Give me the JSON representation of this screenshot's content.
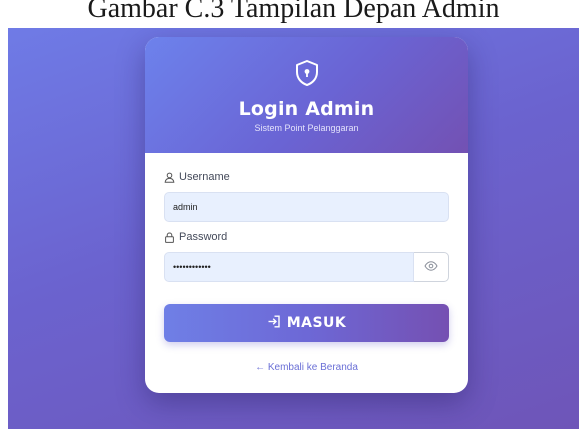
{
  "caption": "Gambar C.3 Tampilan Depan Admin",
  "login": {
    "title": "Login Admin",
    "subtitle": "Sistem Point Pelanggaran",
    "header_icon": "shield-icon",
    "username": {
      "label": "Username",
      "icon": "user-icon",
      "value": "admin"
    },
    "password": {
      "label": "Password",
      "icon": "lock-icon",
      "value": "••••••••••••",
      "toggle_icon": "eye-icon"
    },
    "submit_label": "MASUK",
    "submit_icon": "login-icon",
    "back_link": "← Kembali ke Beranda"
  },
  "colors": {
    "background_start": "#6f7be6",
    "background_end": "#6e55b8",
    "accent": "#6a64d4",
    "input_fill": "#e8f0fe",
    "link": "#6a6fd6"
  }
}
